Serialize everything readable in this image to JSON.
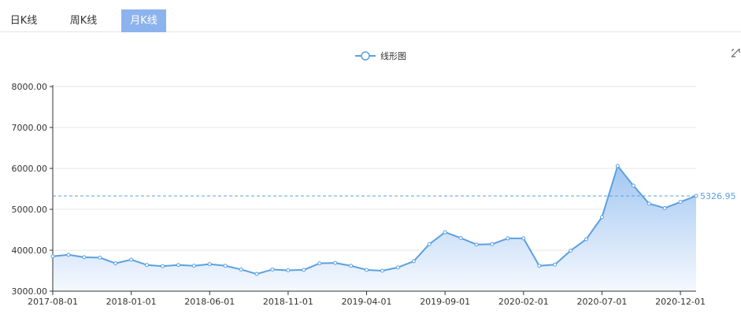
{
  "tabs": [
    {
      "label": "日K线",
      "active": false
    },
    {
      "label": "周K线",
      "active": false
    },
    {
      "label": "月K线",
      "active": true
    }
  ],
  "legend": {
    "label": "线形图"
  },
  "toolbox": {
    "icon": "resize-icon"
  },
  "colors": {
    "accent": "#8db3ee",
    "line": "#5ba0e1",
    "area_top": "#a6c8f2",
    "area_bottom": "#f4f8fe",
    "grid": "#e6e6e6",
    "axis": "#333333",
    "markline": "#5ba0e1"
  },
  "chart_data": {
    "type": "area",
    "series": [
      {
        "name": "线形图",
        "x": [
          "2017-08-01",
          "2017-09-01",
          "2017-10-01",
          "2017-11-01",
          "2017-12-01",
          "2018-01-01",
          "2018-02-01",
          "2018-03-01",
          "2018-04-01",
          "2018-05-01",
          "2018-06-01",
          "2018-07-01",
          "2018-08-01",
          "2018-09-01",
          "2018-10-01",
          "2018-11-01",
          "2018-12-01",
          "2019-01-01",
          "2019-02-01",
          "2019-03-01",
          "2019-04-01",
          "2019-05-01",
          "2019-06-01",
          "2019-07-01",
          "2019-08-01",
          "2019-09-01",
          "2019-10-01",
          "2019-11-01",
          "2019-12-01",
          "2020-01-01",
          "2020-02-01",
          "2020-03-01",
          "2020-04-01",
          "2020-05-01",
          "2020-06-01",
          "2020-07-01",
          "2020-08-01",
          "2020-09-01",
          "2020-10-01",
          "2020-11-01",
          "2020-12-01",
          "2021-01-01"
        ],
        "values": [
          3850,
          3890,
          3830,
          3820,
          3680,
          3770,
          3640,
          3610,
          3640,
          3620,
          3660,
          3620,
          3530,
          3420,
          3530,
          3510,
          3520,
          3680,
          3690,
          3620,
          3520,
          3500,
          3580,
          3730,
          4150,
          4440,
          4300,
          4140,
          4150,
          4290,
          4290,
          3620,
          3650,
          3990,
          4270,
          4810,
          6060,
          5580,
          5140,
          5030,
          5180,
          5330
        ]
      }
    ],
    "x_ticks": [
      "2017-08-01",
      "2018-01-01",
      "2018-06-01",
      "2018-11-01",
      "2019-04-01",
      "2019-09-01",
      "2020-02-01",
      "2020-07-01",
      "2020-12-01"
    ],
    "y_ticks": [
      "3000.00",
      "4000.00",
      "5000.00",
      "6000.00",
      "7000.00",
      "8000.00"
    ],
    "ylim": [
      3000,
      8000
    ],
    "markline": {
      "value": 5326.95,
      "label": "5326.95"
    },
    "grid": true,
    "legend_position": "top-center"
  }
}
